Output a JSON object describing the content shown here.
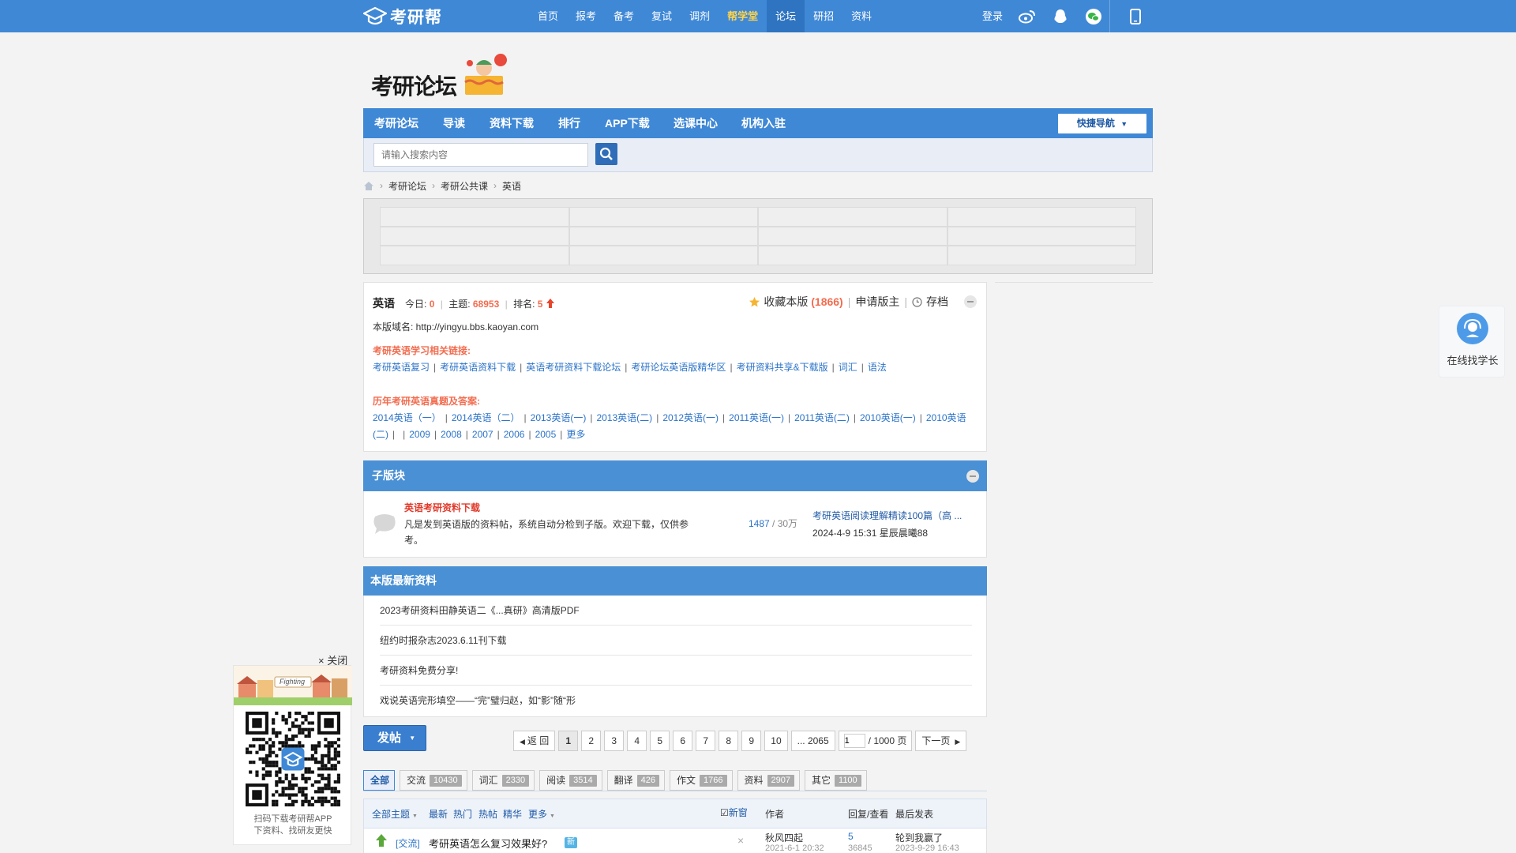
{
  "topbar": {
    "logo": "考研帮",
    "nav": [
      {
        "label": "首页",
        "state": "normal"
      },
      {
        "label": "报考",
        "state": "normal"
      },
      {
        "label": "备考",
        "state": "normal"
      },
      {
        "label": "复试",
        "state": "normal"
      },
      {
        "label": "调剂",
        "state": "normal"
      },
      {
        "label": "帮学堂",
        "state": "highlight"
      },
      {
        "label": "论坛",
        "state": "active"
      },
      {
        "label": "研招",
        "state": "normal"
      },
      {
        "label": "资料",
        "state": "normal"
      }
    ],
    "login": "登录"
  },
  "forum_logo": "考研论坛",
  "forum_nav": {
    "items": [
      "考研论坛",
      "导读",
      "资料下载",
      "排行",
      "APP下载",
      "选课中心",
      "机构入驻"
    ],
    "quick_nav": "快捷导航"
  },
  "search": {
    "placeholder": "请输入搜索内容"
  },
  "breadcrumb": [
    "考研论坛",
    "考研公共课",
    "英语"
  ],
  "forum_info": {
    "name": "英语",
    "today_label": "今日:",
    "today": "0",
    "topics_label": "主题:",
    "topics": "68953",
    "rank_label": "排名:",
    "rank": "5",
    "favorite_label": "收藏本版",
    "favorite_count": "(1866)",
    "apply_moderator": "申请版主",
    "archive": "存档",
    "domain": "本版域名: http://yingyu.bbs.kaoyan.com",
    "links_heading": "考研英语学习相关链接:",
    "links": [
      "考研英语复习",
      "考研英语资料下载",
      "英语考研资料下载论坛",
      "考研论坛英语版精华区",
      "考研资料共享&下载版",
      "词汇",
      "语法"
    ],
    "exams_heading": "历年考研英语真题及答案:",
    "exams_line1": [
      "2014英语（一）",
      "2014英语（二）",
      "2013英语(一)",
      "2013英语(二)",
      "2012英语(一)",
      "2011英语(一)",
      "2011英语(二)",
      "2010英语(一)",
      "2010英语"
    ],
    "exams_line2": [
      "(二)",
      "2009",
      "2008",
      "2007",
      "2006",
      "2005",
      "更多"
    ]
  },
  "subforum": {
    "heading": "子版块",
    "name": "英语考研资料下载",
    "description": "凡是发到英语版的资料帖，系统自动分检到子版。欢迎下载，仅供参考。",
    "threads": "1487",
    "posts": " / 30万",
    "last_post_title": "考研英语阅读理解精读100篇（高 ...",
    "last_post_meta": "2024-4-9 15:31 星辰晨曦88"
  },
  "latest": {
    "heading": "本版最新资料",
    "items": [
      "2023考研资料田静英语二《...真研》高清版PDF",
      "纽约时报杂志2023.6.11刊下载",
      "考研资料免费分享!",
      "戏说英语完形填空——“完”璧归赵，如“影”随“形"
    ]
  },
  "pager": {
    "post_button": "发帖",
    "back": "返 回",
    "pages": [
      "1",
      "2",
      "3",
      "4",
      "5",
      "6",
      "7",
      "8",
      "9",
      "10"
    ],
    "last": "... 2065",
    "page_input": "1",
    "total": "/ 1000 页",
    "next": "下一页"
  },
  "tabs": [
    {
      "label": "全部",
      "count": ""
    },
    {
      "label": "交流",
      "count": "10430"
    },
    {
      "label": "词汇",
      "count": "2330"
    },
    {
      "label": "阅读",
      "count": "3514"
    },
    {
      "label": "翻译",
      "count": "426"
    },
    {
      "label": "作文",
      "count": "1766"
    },
    {
      "label": "资料",
      "count": "2907"
    },
    {
      "label": "其它",
      "count": "1100"
    }
  ],
  "thread_header": {
    "all": "全部主题",
    "filters": [
      "最新",
      "热门",
      "热帖",
      "精华",
      "更多"
    ],
    "new_window": "新窗",
    "author": "作者",
    "replies": "回复/查看",
    "last_post": "最后发表"
  },
  "thread_row": {
    "type": "[交流]",
    "title": "考研英语怎么复习效果好?",
    "badge": "新",
    "author": "秋风四起",
    "author_date": "2021-6-1 20:32",
    "replies": "5",
    "views": "36845",
    "last_user": "轮到我赢了",
    "last_date": "2023-9-29 16:43"
  },
  "qr_floater": {
    "close": "× 关闭",
    "banner": "Fighting",
    "caption1": "扫码下载考研帮APP",
    "caption2": "下资料、找研友更快"
  },
  "senior": {
    "label": "在线找学长"
  },
  "colors": {
    "brand": "#3f88d6",
    "accent": "#f26c4f",
    "link": "#2b73c8"
  }
}
